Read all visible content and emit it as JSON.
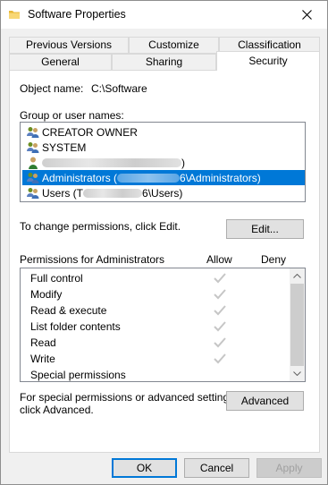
{
  "window": {
    "title": "Software Properties"
  },
  "tabs": {
    "row1": [
      "Previous Versions",
      "Customize",
      "Classification"
    ],
    "row2": [
      "General",
      "Sharing",
      "Security"
    ],
    "selected": "Security"
  },
  "security": {
    "object_name_label": "Object name:",
    "object_name_value": "C:\\Software",
    "group_label": "Group or user names:",
    "users": [
      {
        "label": "CREATOR OWNER",
        "icon": "users-group-icon"
      },
      {
        "label": "SYSTEM",
        "icon": "users-group-icon"
      },
      {
        "label": "",
        "suffix": ")",
        "icon": "user-icon"
      },
      {
        "label": "Administrators (",
        "suffix": "6\\Administrators)",
        "icon": "users-group-icon",
        "selected": true
      },
      {
        "label": "Users (",
        "prefix_tail": "T",
        "suffix": "6\\Users)",
        "icon": "users-group-icon"
      }
    ],
    "change_hint": "To change permissions, click Edit.",
    "edit_button": "Edit...",
    "permissions_for": "Permissions for Administrators",
    "allow_label": "Allow",
    "deny_label": "Deny",
    "permissions": [
      {
        "name": "Full control",
        "allow": true
      },
      {
        "name": "Modify",
        "allow": true
      },
      {
        "name": "Read & execute",
        "allow": true
      },
      {
        "name": "List folder contents",
        "allow": true
      },
      {
        "name": "Read",
        "allow": true
      },
      {
        "name": "Write",
        "allow": true
      },
      {
        "name": "Special permissions",
        "allow": false
      }
    ],
    "special_hint_line1": "For special permissions or advanced settings,",
    "special_hint_line2": "click Advanced.",
    "advanced_button": "Advanced"
  },
  "footer": {
    "ok": "OK",
    "cancel": "Cancel",
    "apply": "Apply"
  },
  "colors": {
    "selection": "#0078d7",
    "check": "#c6c6c6",
    "dialog_bg": "#f0f0f0"
  }
}
